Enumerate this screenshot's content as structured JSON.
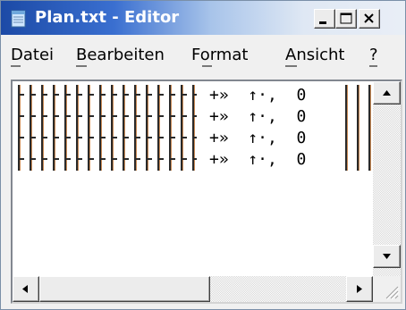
{
  "window": {
    "title": "Plan.txt - Editor",
    "accent_color": "#1c4aa6",
    "controls": [
      "minimize-icon",
      "maximize-icon",
      "close-icon"
    ]
  },
  "menu": {
    "items": [
      {
        "label": "Datei"
      },
      {
        "label": "Bearbeiten"
      },
      {
        "label": "Format"
      },
      {
        "label": "Ansicht"
      },
      {
        "label": "?"
      }
    ]
  },
  "editor": {
    "lines": [
      {
        "text": "+»  ↑·,  0"
      },
      {
        "text": "+»  ↑·,  0"
      },
      {
        "text": "+»  ↑·,  0"
      },
      {
        "text": "+»  ↑·,  0"
      }
    ]
  }
}
